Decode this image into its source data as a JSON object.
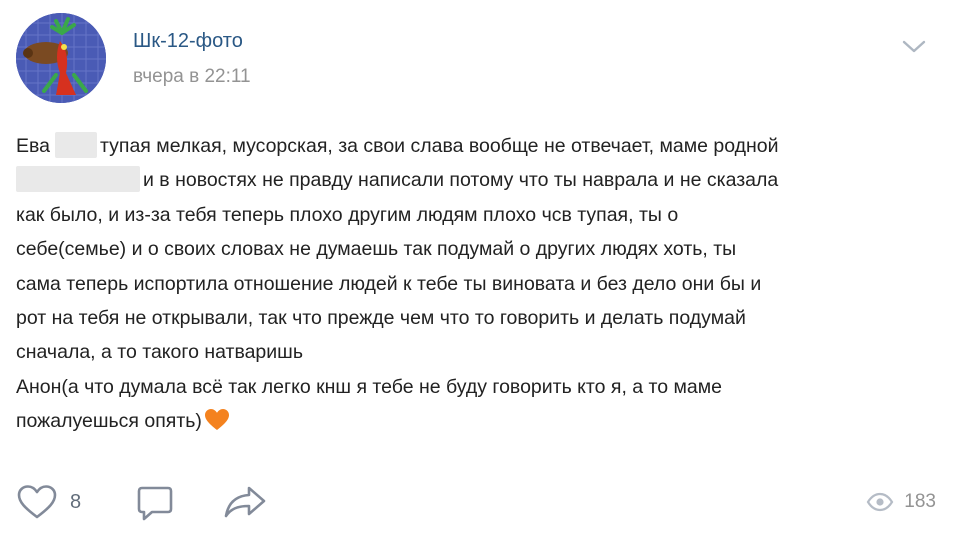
{
  "post": {
    "author": "Шк-12-фото",
    "timestamp": "вчера в 22:11",
    "text": {
      "l1a": "Ева",
      "l1b": "тупая мелкая, мусорская, за свои слава вообще не отвечает, маме родной",
      "l2": "и в новостях не правду написали потому что ты наврала и не сказала",
      "l3": "как было, и из-за тебя теперь плохо другим людям плохо чсв тупая, ты о",
      "l4": "себе(семье) и о своих словах не думаешь так подумай о других людях хоть, ты",
      "l5": "сама теперь испортила отношение людей к тебе ты виновата и без дело они бы и",
      "l6": "рот на тебя не открывали, так что прежде чем что то говорить и делать подумай",
      "l7": "сначала, а то такого натваришь",
      "l8": "Анон(а что думала всё так легко кнш я тебе не буду говорить кто я, а то маме",
      "l9": "пожалуешься опять)"
    },
    "likes": "8",
    "views": "183"
  },
  "icons": {
    "menu": "chevron-down-icon",
    "like": "heart-outline-icon",
    "comment": "comment-bubble-icon",
    "share": "share-arrow-icon",
    "views": "eye-icon",
    "emoji": "orange-heart-emoji"
  },
  "colors": {
    "author_link": "#2a5885",
    "muted": "#939393",
    "icon": "#828a99",
    "emoji_heart": "#f4821f"
  }
}
